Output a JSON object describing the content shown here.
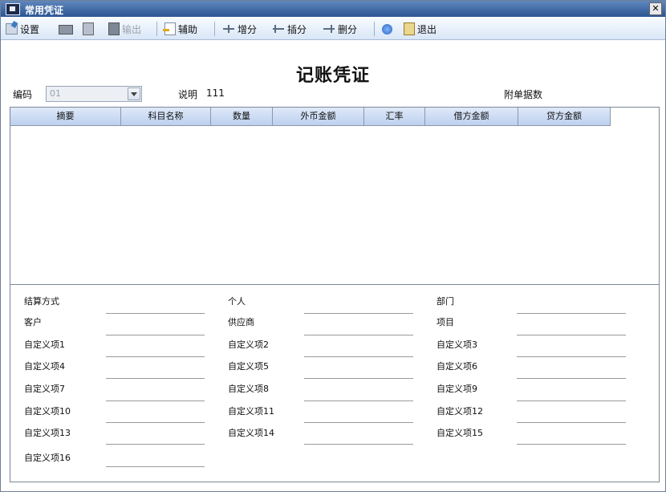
{
  "window": {
    "title": "常用凭证",
    "close_glyph": "✕"
  },
  "toolbar": {
    "buttons": [
      {
        "label": "设置",
        "icon": "setup-icon"
      },
      {
        "label": "",
        "icon": "print-icon"
      },
      {
        "label": "",
        "icon": "preview-icon"
      },
      {
        "label": "输出",
        "icon": "export-icon",
        "disabled": true
      },
      {
        "label": "辅助",
        "icon": "assist-icon"
      },
      {
        "label": "增分",
        "icon": "split-icon"
      },
      {
        "label": "插分",
        "icon": "insert-icon"
      },
      {
        "label": "删分",
        "icon": "delete-icon"
      },
      {
        "label": "",
        "icon": "help-icon"
      },
      {
        "label": "退出",
        "icon": "exit-icon"
      }
    ]
  },
  "voucher": {
    "title": "记账凭证",
    "code_label": "编码",
    "code_value": "01",
    "desc_label": "说明",
    "desc_value": "111",
    "attachments_label": "附单据数"
  },
  "grid": {
    "columns": [
      "摘要",
      "科目名称",
      "数量",
      "外币金额",
      "汇率",
      "借方金额",
      "贷方金额"
    ]
  },
  "fields": {
    "col1": [
      "结算方式",
      "客户",
      "自定义项1",
      "自定义项4",
      "自定义项7",
      "自定义项10",
      "自定义项13",
      "自定义项16"
    ],
    "col2": [
      "个人",
      "供应商",
      "自定义项2",
      "自定义项5",
      "自定义项8",
      "自定义项11",
      "自定义项14"
    ],
    "col3": [
      "部门",
      "项目",
      "自定义项3",
      "自定义项6",
      "自定义项9",
      "自定义项12",
      "自定义项15"
    ]
  },
  "colors": {
    "title_bar": "#2c5593",
    "toolbar": "#d9e6f7",
    "grid_header": "#bcd0ef"
  }
}
